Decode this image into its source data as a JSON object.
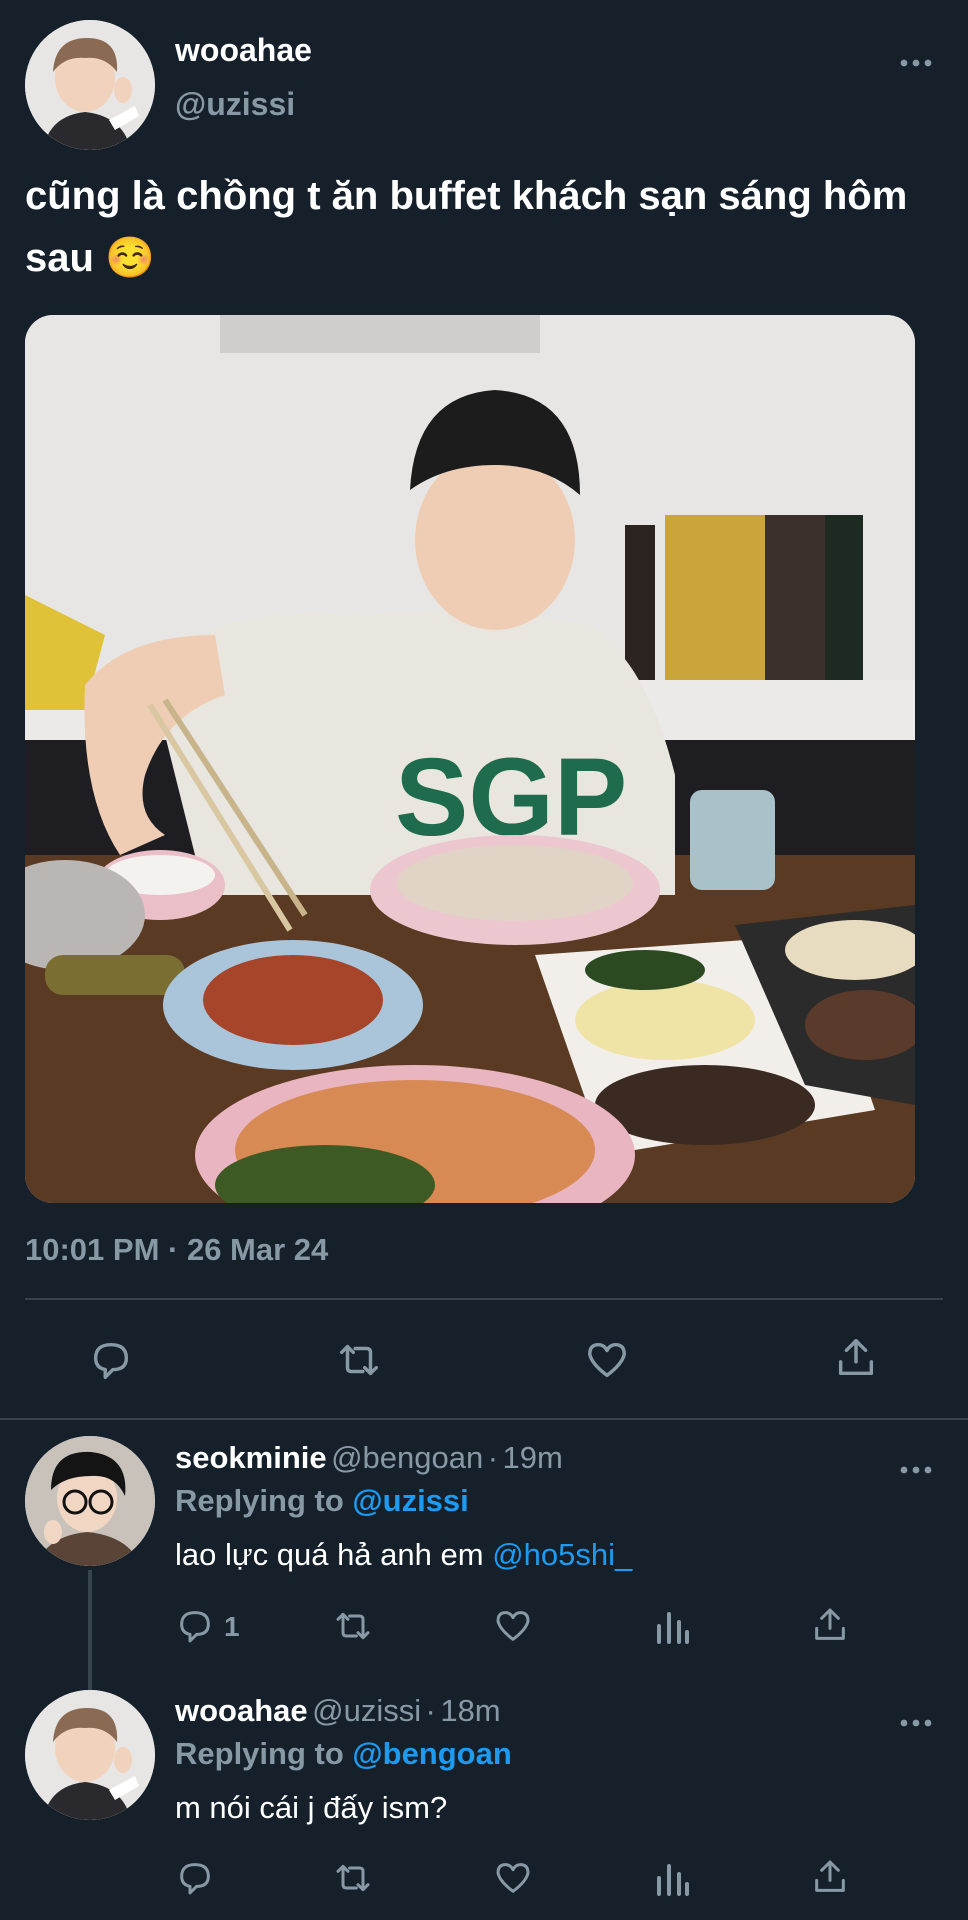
{
  "main_tweet": {
    "display_name": "wooahae",
    "handle": "@uzissi",
    "text": "cũng là chồng t ăn buffet khách sạn sáng hôm sau ☺️",
    "timestamp": "10:01 PM · 26 Mar 24"
  },
  "replies": [
    {
      "display_name": "seokminie",
      "handle": "@bengoan",
      "time": "19m",
      "replying_label": "Replying to",
      "replying_to": "@uzissi",
      "text": "lao lực quá hả anh em",
      "mention": "@ho5shi_",
      "reply_count": "1"
    },
    {
      "display_name": "wooahae",
      "handle": "@uzissi",
      "time": "18m",
      "replying_label": "Replying to",
      "replying_to": "@bengoan",
      "text": "m nói cái j đấy ism?"
    }
  ],
  "separator": "·",
  "colors": {
    "background": "#15202b",
    "muted": "#8899a6",
    "link": "#1d9bf0",
    "divider": "#38444d"
  },
  "icons": [
    "reply-icon",
    "retweet-icon",
    "like-icon",
    "share-icon",
    "analytics-icon",
    "more-icon"
  ]
}
